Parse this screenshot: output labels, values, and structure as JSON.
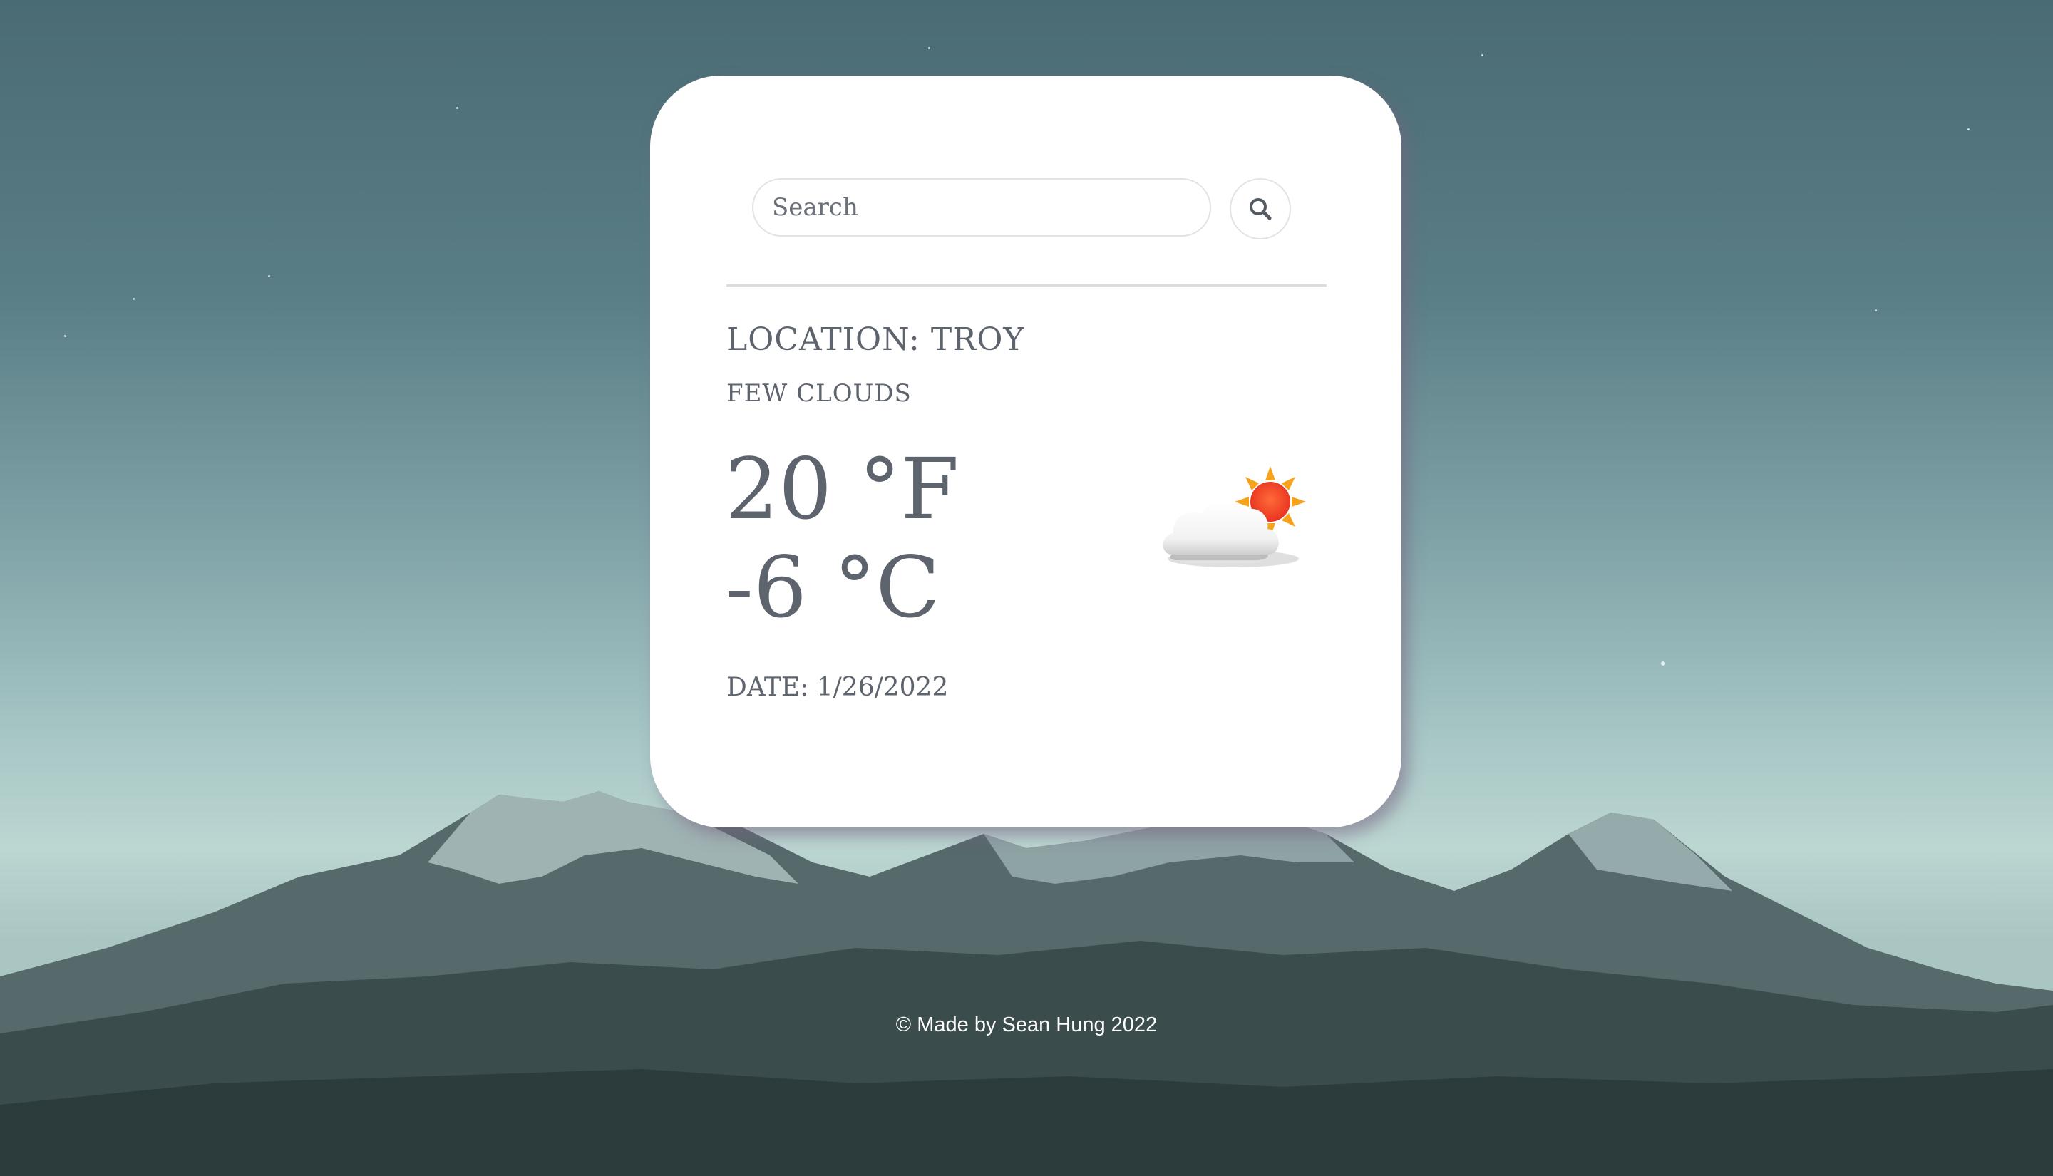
{
  "search": {
    "placeholder": "Search",
    "button_icon": "search-icon"
  },
  "weather": {
    "location": "LOCATION: TROY",
    "condition": "FEW CLOUDS",
    "temp_f": "20 °F",
    "temp_c": "-6 °C",
    "date": "DATE: 1/26/2022",
    "icon": "few-clouds-icon"
  },
  "footer": {
    "text": "© Made by Sean Hung 2022"
  },
  "colors": {
    "card_background": "#ffffff",
    "text": "#5e646d",
    "footer_text": "#ffffff"
  }
}
